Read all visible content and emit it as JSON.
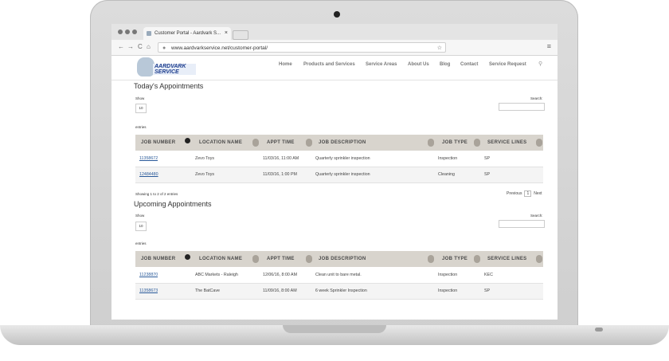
{
  "browser": {
    "tab_title": "Customer Portal - Aardvark S...",
    "tab_close": "×",
    "url": "www.aardvarkservice.net/customer-portal/",
    "star": "☆",
    "back": "←",
    "forward": "→",
    "reload": "C",
    "home": "⌂",
    "menu": "≡"
  },
  "site": {
    "logo_text": "AARDVARK SERVICE",
    "nav": [
      "Home",
      "Products and Services",
      "Service Areas",
      "About Us",
      "Blog",
      "Contact",
      "Service Request"
    ],
    "search_icon": "⚲"
  },
  "today": {
    "title": "Today's Appointments",
    "show_label": "Show",
    "show_value": "10",
    "entries_label": "entries",
    "search_label": "Search:",
    "columns": [
      "JOB NUMBER",
      "LOCATION NAME",
      "APPT TIME",
      "JOB DESCRIPTION",
      "JOB TYPE",
      "SERVICE LINES"
    ],
    "rows": [
      [
        "11358672",
        "Zevo Toys",
        "11/03/16, 11:00 AM",
        "Quarterly sprinkler inspection",
        "Inspection",
        "SP"
      ],
      [
        "12484480",
        "Zevo Toys",
        "11/03/16, 1:00 PM",
        "Quarterly sprinkler inspection",
        "Cleaning",
        "SP"
      ]
    ],
    "info": "Showing 1 to 2 of 2 entries",
    "pager": {
      "prev": "Previous",
      "page": "1",
      "next": "Next"
    }
  },
  "upcoming": {
    "title": "Upcoming Appointments",
    "show_label": "Show",
    "show_value": "10",
    "entries_label": "entries",
    "search_label": "Search:",
    "columns": [
      "JOB NUMBER",
      "LOCATION NAME",
      "APPT TIME",
      "JOB DESCRIPTION",
      "JOB TYPE",
      "SERVICE LINES"
    ],
    "rows": [
      [
        "11238870",
        "ABC Markets - Raleigh",
        "12/06/16, 8:00 AM",
        "Clean unit to bare metal.",
        "Inspection",
        "KEC"
      ],
      [
        "11358673",
        "The BatCave",
        "11/09/16, 8:00 AM",
        "6 week Sprinkler Inspection",
        "Inspection",
        "SP"
      ]
    ]
  },
  "colors": {
    "header_bg": "#d8d4cd",
    "link": "#2a5a9a",
    "logo": "#1f3f8f"
  }
}
